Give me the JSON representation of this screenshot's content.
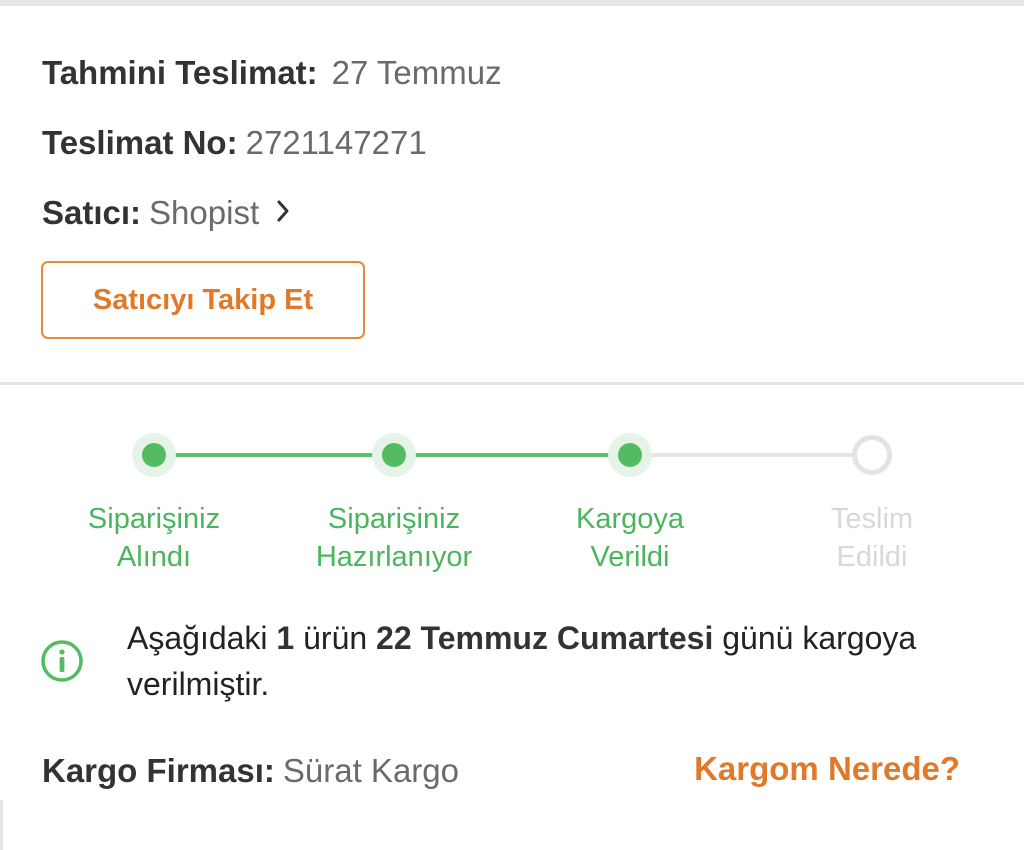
{
  "delivery": {
    "eta_label": "Tahmini Teslimat:",
    "eta_value": "27 Temmuz",
    "number_label": "Teslimat No:",
    "number_value": "2721147271",
    "seller_label": "Satıcı:",
    "seller_value": "Shopist",
    "follow_button": "Satıcıyı Takip Et"
  },
  "tracker": {
    "steps": [
      {
        "label": "Siparişiniz\nAlındı",
        "status": "done"
      },
      {
        "label": "Siparişiniz\nHazırlanıyor",
        "status": "done"
      },
      {
        "label": "Kargoya\nVerildi",
        "status": "done"
      },
      {
        "label": "Teslim\nEdildi",
        "status": "pending"
      }
    ]
  },
  "notice": {
    "icon": "info-icon",
    "part1": "Aşağıdaki ",
    "count": "1",
    "part2": " ürün ",
    "date": "22 Temmuz Cumartesi",
    "part3": " günü kargoya verilmiştir."
  },
  "cargo": {
    "label": "Kargo Firması:",
    "value": "Sürat Kargo",
    "link": "Kargom Nerede?"
  },
  "colors": {
    "accent_orange": "#e07a2a",
    "success_green": "#54bb63",
    "pending_gray": "#d8d8d8"
  }
}
